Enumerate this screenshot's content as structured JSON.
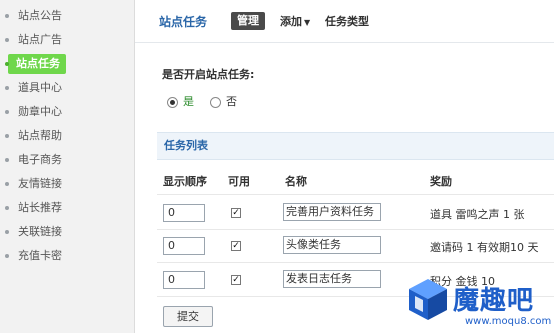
{
  "sidebar": {
    "items": [
      {
        "label": "站点公告",
        "active": false
      },
      {
        "label": "站点广告",
        "active": false
      },
      {
        "label": "站点任务",
        "active": true
      },
      {
        "label": "道具中心",
        "active": false
      },
      {
        "label": "勋章中心",
        "active": false
      },
      {
        "label": "站点帮助",
        "active": false
      },
      {
        "label": "电子商务",
        "active": false
      },
      {
        "label": "友情链接",
        "active": false
      },
      {
        "label": "站长推荐",
        "active": false
      },
      {
        "label": "关联链接",
        "active": false
      },
      {
        "label": "充值卡密",
        "active": false
      }
    ]
  },
  "header": {
    "title": "站点任务",
    "tab_manage": "管理",
    "tab_add": "添加",
    "tab_type": "任务类型"
  },
  "settings": {
    "question": "是否开启站点任务:",
    "option_yes": "是",
    "option_no": "否",
    "selected": "是"
  },
  "task_list": {
    "section_title": "任务列表",
    "columns": [
      "显示顺序",
      "可用",
      "名称",
      "奖励"
    ],
    "rows": [
      {
        "order": "0",
        "enabled": true,
        "name": "完善用户资料任务",
        "reward": "道具 雷鸣之声 1 张"
      },
      {
        "order": "0",
        "enabled": true,
        "name": "头像类任务",
        "reward": "邀请码 1 有效期10 天"
      },
      {
        "order": "0",
        "enabled": true,
        "name": "发表日志任务",
        "reward": "积分 金钱 10"
      }
    ],
    "submit_label": "提交"
  },
  "watermark": {
    "text": "魔趣吧",
    "url": "www.moqu8.com",
    "color": "#1f5fc9"
  },
  "colors": {
    "accent": "#2a66a8",
    "active_nav": "#6fd74b"
  }
}
